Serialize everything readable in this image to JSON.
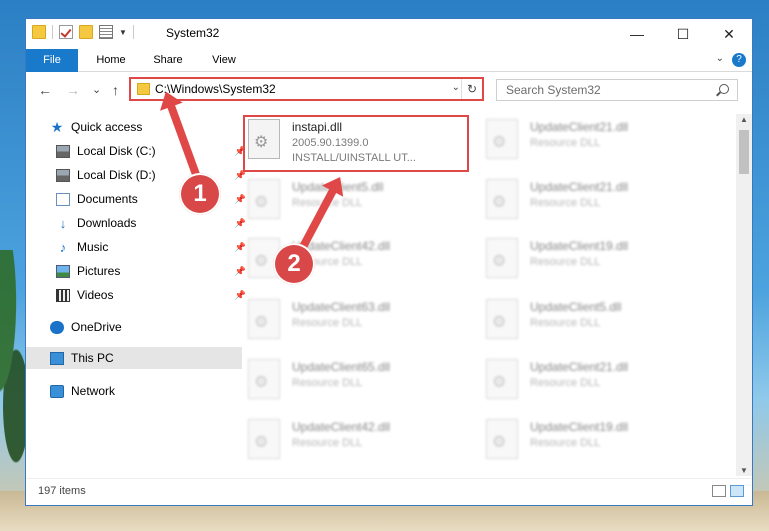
{
  "window": {
    "title": "System32"
  },
  "ribbon": {
    "tabs": [
      "File",
      "Home",
      "Share",
      "View"
    ],
    "help": "?"
  },
  "controls": {
    "minimize": "—",
    "maximize": "☐",
    "close": "✕"
  },
  "nav": {
    "back": "←",
    "forward": "→",
    "recent": "⌄",
    "up": "↑"
  },
  "address": {
    "path": "C:\\Windows\\System32",
    "dropdown": "⌄",
    "refresh": "↻"
  },
  "search": {
    "placeholder": "Search System32"
  },
  "sidebar": {
    "items": [
      {
        "label": "Quick access"
      },
      {
        "label": "Local Disk (C:)"
      },
      {
        "label": "Local Disk (D:)"
      },
      {
        "label": "Documents"
      },
      {
        "label": "Downloads"
      },
      {
        "label": "Music"
      },
      {
        "label": "Pictures"
      },
      {
        "label": "Videos"
      },
      {
        "label": "OneDrive"
      },
      {
        "label": "This PC"
      },
      {
        "label": "Network"
      }
    ]
  },
  "files": {
    "main": {
      "name": "instapi.dll",
      "version": "2005.90.1399.0",
      "description": "INSTALL/UINSTALL UT..."
    },
    "others": [
      {
        "name": "UpdateClient21.dll",
        "type": "Resource DLL"
      },
      {
        "name": "UpdateClient5.dll",
        "type": "Resource DLL"
      },
      {
        "name": "UpdateClient21.dll",
        "type": "Resource DLL"
      },
      {
        "name": "UpdateClient42.dll",
        "type": "Resource DLL"
      },
      {
        "name": "UpdateClient19.dll",
        "type": "Resource DLL"
      },
      {
        "name": "UpdateClient63.dll",
        "type": "Resource DLL"
      },
      {
        "name": "UpdateClient5.dll",
        "type": "Resource DLL"
      },
      {
        "name": "UpdateClient65.dll",
        "type": "Resource DLL"
      },
      {
        "name": "UpdateClient21.dll",
        "type": "Resource DLL"
      },
      {
        "name": "UpdateClient42.dll",
        "type": "Resource DLL"
      },
      {
        "name": "UpdateClient19.dll",
        "type": "Resource DLL"
      }
    ]
  },
  "status": {
    "count": "197 items"
  },
  "annotations": {
    "step1": "1",
    "step2": "2"
  }
}
